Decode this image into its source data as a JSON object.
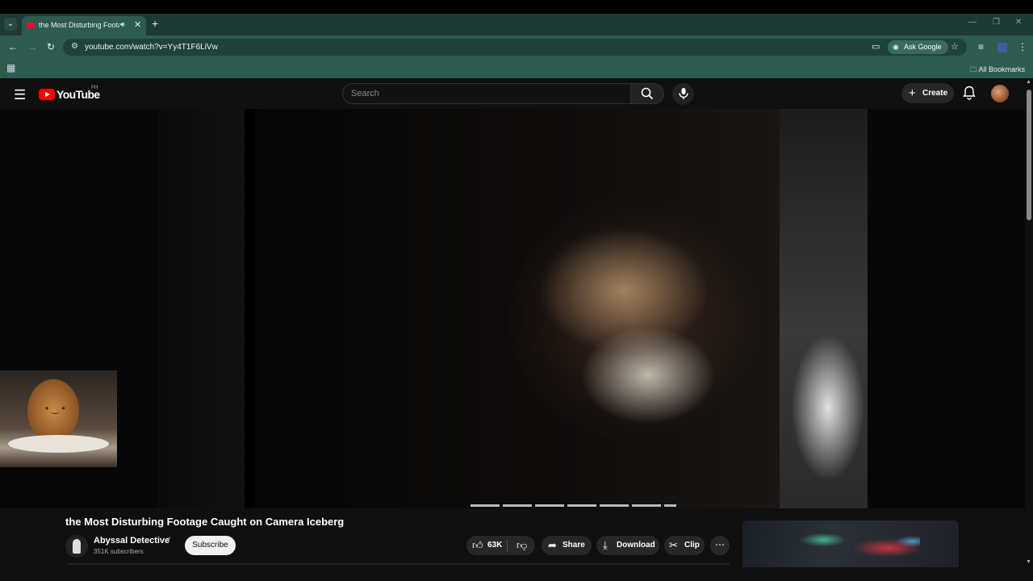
{
  "browser": {
    "tab_title": "the Most Disturbing Footage Caught on Camera Iceberg",
    "url": "youtube.com/watch?v=Yy4T1F6LiVw",
    "ask_google": "Ask Google",
    "all_bookmarks": "All Bookmarks"
  },
  "youtube": {
    "logo_text": "YouTube",
    "country_code": "PH",
    "search_placeholder": "Search",
    "create_label": "Create"
  },
  "video": {
    "title": "the Most Disturbing Footage Caught on Camera Iceberg",
    "channel": "Abyssal Detective",
    "subscribers": "351K subscribers",
    "subscribe_label": "Subscribe",
    "likes": "63K",
    "share_label": "Share",
    "download_label": "Download",
    "clip_label": "Clip"
  },
  "colors": {
    "chrome_tabstrip": "#1f3a34",
    "chrome_toolbar": "#2e5b50",
    "yt_background": "#0f0f0f",
    "yt_red": "#ff0000"
  },
  "icons": [
    "tab-search-icon",
    "audio-icon",
    "close-icon",
    "new-tab-icon",
    "back-icon",
    "forward-icon",
    "reload-icon",
    "site-info-icon",
    "cast-icon",
    "star-icon",
    "extensions-icon",
    "profile-icon",
    "menu-icon",
    "apps-icon",
    "folder-icon",
    "hamburger-icon",
    "search-icon",
    "mic-icon",
    "bell-icon",
    "like-icon",
    "dislike-icon",
    "share-icon",
    "download-icon",
    "clip-icon",
    "more-icon",
    "verified-icon"
  ]
}
